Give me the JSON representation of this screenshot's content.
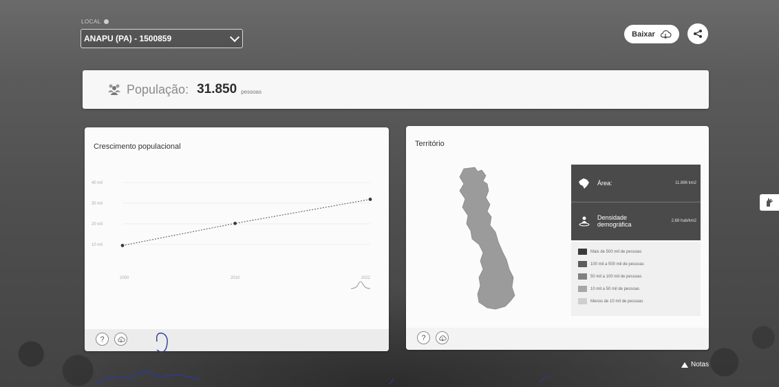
{
  "local": {
    "label": "LOCAL",
    "selected": "ANAPU (PA) - 1500859"
  },
  "toolbar": {
    "download_label": "Baixar"
  },
  "population": {
    "label": "População:",
    "value": "31.850",
    "unit": "pessoas"
  },
  "growth_panel": {
    "title": "Crescimento populacional"
  },
  "chart_data": {
    "type": "line",
    "title": "Crescimento populacional",
    "xlabel": "",
    "ylabel": "",
    "y_tick_labels": [
      "10 mil",
      "20 mil",
      "30 mil",
      "40 mil"
    ],
    "x_tick_labels": [
      "2000",
      "2010",
      "2022"
    ],
    "x": [
      2000,
      2010,
      2022
    ],
    "values": [
      9500,
      20200,
      31850
    ],
    "ylim": [
      0,
      45000
    ],
    "grid": true
  },
  "territory_panel": {
    "title": "Território",
    "area_label": "Área:",
    "area_value": "11.896 km2",
    "density_label_line1": "Densidade",
    "density_label_line2": "demográfica",
    "density_value": "2,68 hab/km2",
    "legend": [
      {
        "label": "Mais de 500 mil de pessoas",
        "color": "#3a3a3a"
      },
      {
        "label": "100 mil a 500 mil de pessoas",
        "color": "#5c5c5c"
      },
      {
        "label": "50 mil a 100 mil de pessoas",
        "color": "#808080"
      },
      {
        "label": "10 mil a 50 mil de pessoas",
        "color": "#a7a7a7"
      },
      {
        "label": "Menos de 10 mil de pessoas",
        "color": "#cfcfcf"
      }
    ]
  },
  "footer": {
    "help_label": "?",
    "notes_label": "Notas"
  }
}
